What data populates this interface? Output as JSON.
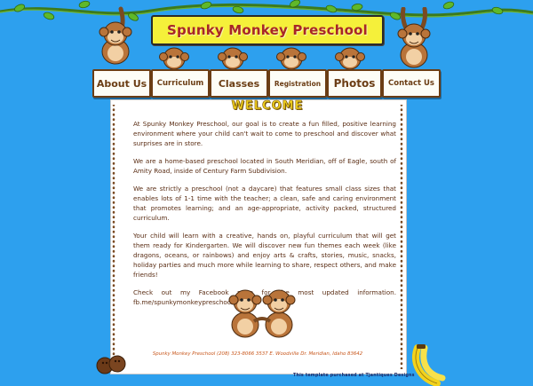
{
  "site": {
    "title": "Spunky Monkey Preschool"
  },
  "nav": {
    "items": [
      {
        "label": "About Us"
      },
      {
        "label": "Curriculum"
      },
      {
        "label": "Classes"
      },
      {
        "label": "Registration"
      },
      {
        "label": "Photos"
      },
      {
        "label": "Contact Us"
      }
    ]
  },
  "main": {
    "heading": "WELCOME",
    "paragraphs": [
      "At Spunky Monkey Preschool, our goal is to create a fun filled, positive learning environment where your child can't wait to come to preschool and discover what surprises are in store.",
      "We are a home-based preschool located in South Meridian, off of Eagle, south of Amity Road, inside of Century Farm Subdivision.",
      "We are strictly a preschool (not a daycare) that features small class sizes that enables lots of 1-1 time with the teacher; a clean, safe and caring environment that promotes learning; and an age-appropriate, activity packed, structured curriculum.",
      "Your child will learn with a creative, hands on, playful curriculum that will get them ready for Kindergarten. We will discover new fun themes each week (like dragons, oceans, or rainbows) and enjoy arts & crafts, stories, music, snacks, holiday parties and much more while learning to share, respect others, and make friends!",
      "Check out my Facebook page for the most updated information. fb.me/spunkymonkeypreschool"
    ]
  },
  "footer": {
    "info": "Spunky Monkey Preschool (208) 323-8066 3537 E. Woodville Dr. Meridian, Idaho 83642",
    "credit": "This template purchased at Tjantiques Designs"
  },
  "colors": {
    "background": "#2da0ee",
    "banner": "#f5f03a",
    "title_text": "#a82626",
    "nav_text": "#6b3d14",
    "body_text": "#5a2d14",
    "footer_text": "#c8571c"
  },
  "icons": [
    "monkey-icon",
    "vine-icon",
    "coconut-icon",
    "banana-icon"
  ]
}
